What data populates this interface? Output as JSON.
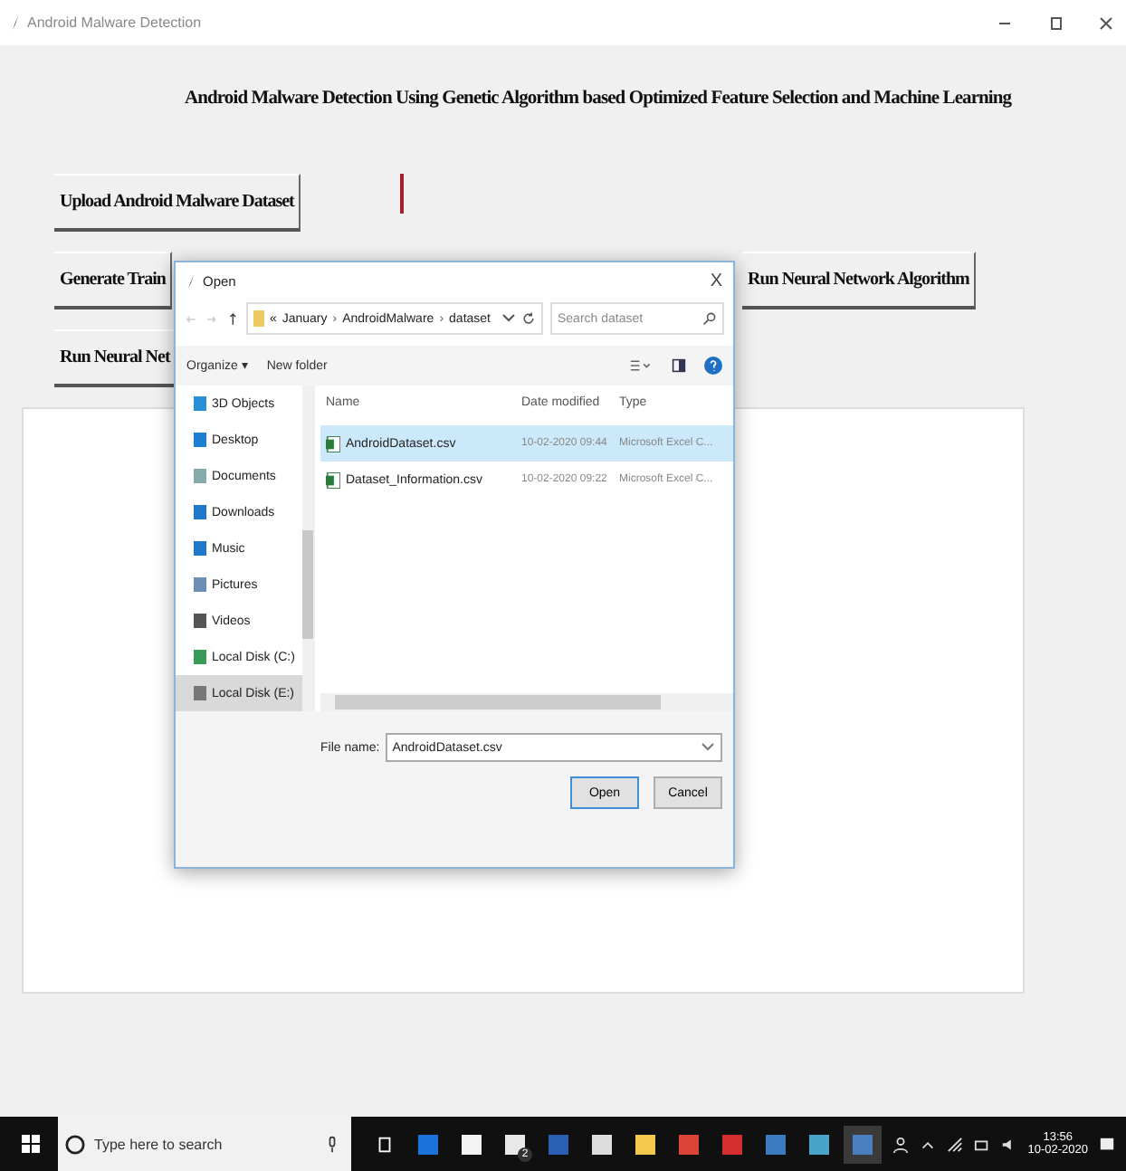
{
  "window": {
    "title": "Android Malware Detection"
  },
  "heading": "Android Malware Detection Using Genetic Algorithm based Optimized Feature Selection and Machine Learning",
  "button_rows": [
    [
      "Upload Android Malware Dataset"
    ],
    [
      "Generate Train",
      "Run Neural Network Algorithm"
    ],
    [
      "Run Neural Net"
    ]
  ],
  "dialog": {
    "title": "Open",
    "close": "X",
    "path_prefix": "«",
    "path_separator": "›",
    "path": [
      "January",
      "AndroidMalware",
      "dataset"
    ],
    "search": {
      "placeholder": "Search dataset"
    },
    "toolbar": [
      "Organize ▾",
      "New folder"
    ],
    "nav_items": [
      {
        "label": "3D Objects",
        "selected": false
      },
      {
        "label": "Desktop",
        "selected": false
      },
      {
        "label": "Documents",
        "selected": false
      },
      {
        "label": "Downloads",
        "selected": false
      },
      {
        "label": "Music",
        "selected": false
      },
      {
        "label": "Pictures",
        "selected": false
      },
      {
        "label": "Videos",
        "selected": false
      },
      {
        "label": "Local Disk (C:)",
        "selected": false
      },
      {
        "label": "Local Disk (E:)",
        "selected": true
      }
    ],
    "columns": [
      "Name",
      "Date modified",
      "Type"
    ],
    "files": [
      {
        "name": "AndroidDataset.csv",
        "date": "10-02-2020 09:44",
        "type": "Microsoft Excel C...",
        "selected": true
      },
      {
        "name": "Dataset_Information.csv",
        "date": "10-02-2020 09:22",
        "type": "Microsoft Excel C...",
        "selected": false
      }
    ],
    "file_name_label": "File name:",
    "file_name": "AndroidDataset.csv",
    "open": "Open",
    "cancel": "Cancel"
  },
  "taskbar": {
    "search": {
      "placeholder": "Type here to search"
    },
    "mail_badge": "2",
    "time": "13:56",
    "date": "10-02-2020"
  }
}
